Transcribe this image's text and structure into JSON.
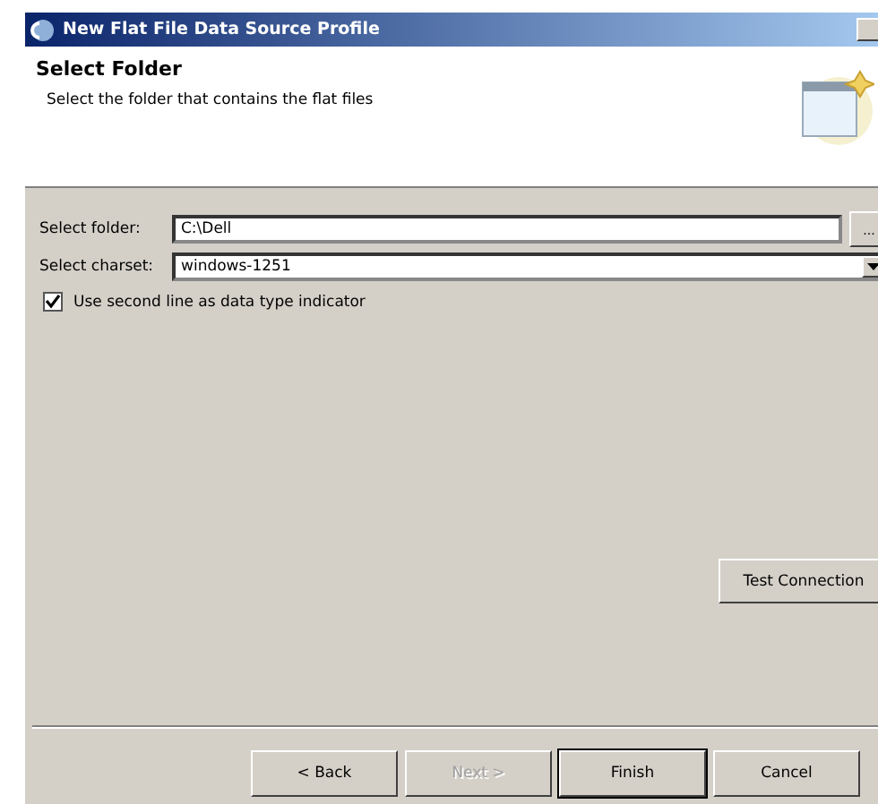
{
  "window": {
    "title": "New Flat File Data Source Profile"
  },
  "header": {
    "title": "Select Folder",
    "description": "Select the folder that contains the flat files"
  },
  "fields": [
    {
      "kind": "browse",
      "label": "Select folder:",
      "value": "C:\\Dell",
      "button": "..."
    },
    {
      "kind": "dropdown",
      "label": "Select charset:",
      "value": "windows-1251"
    }
  ],
  "options": [
    {
      "label": "Use second line as data type indicator",
      "checked": true
    }
  ],
  "test_button": "Test Connection",
  "buttons": [
    {
      "label": "< Back",
      "disabled": false,
      "default": false
    },
    {
      "label": "Next >",
      "disabled": true,
      "default": false
    },
    {
      "label": "Finish",
      "disabled": false,
      "default": true
    },
    {
      "label": "Cancel",
      "disabled": false,
      "default": false
    }
  ]
}
